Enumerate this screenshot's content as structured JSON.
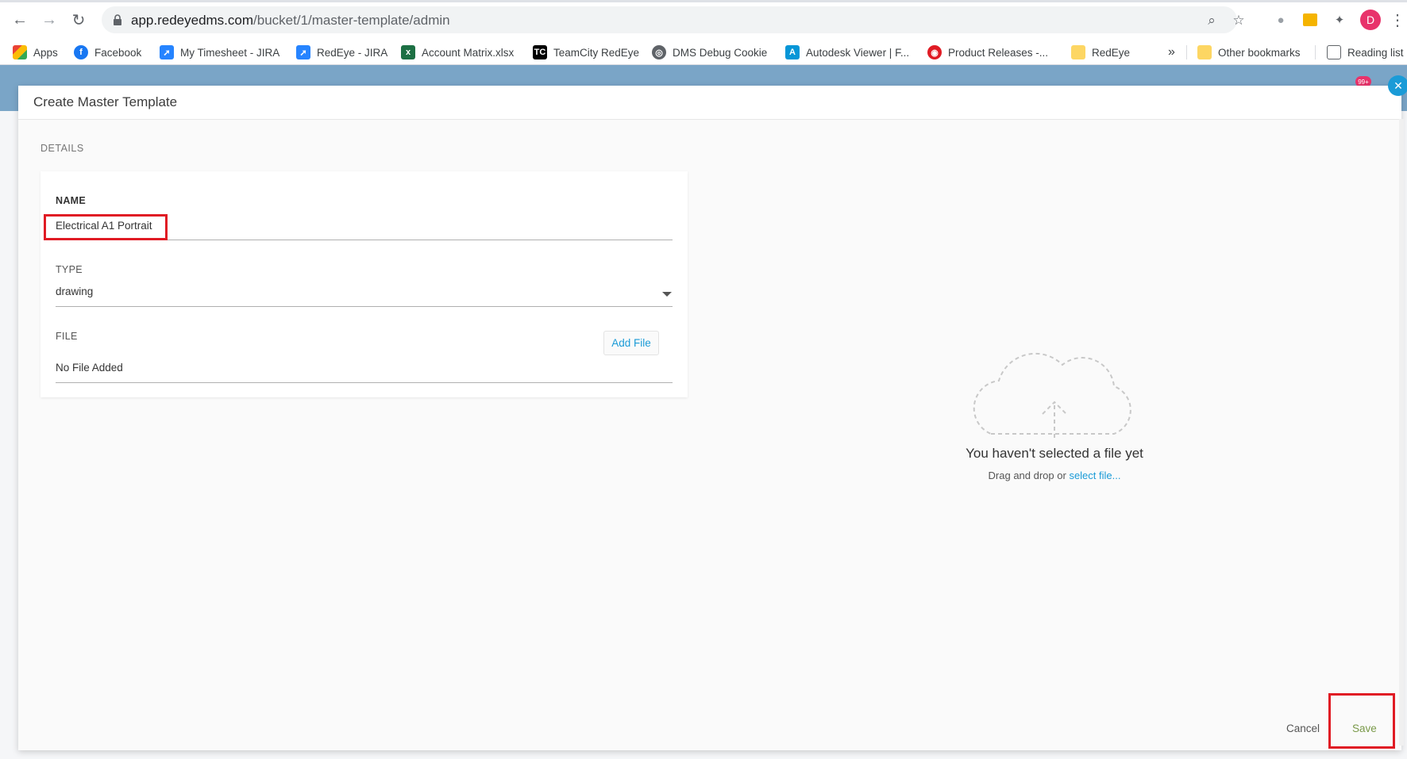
{
  "browser": {
    "url_host": "app.redeyedms.com",
    "url_path": "/bucket/1/master-template/admin",
    "profile_initial": "D",
    "bookmarks": [
      {
        "label": "Apps",
        "icon": "apps-grid-icon"
      },
      {
        "label": "Facebook",
        "icon": "facebook-icon"
      },
      {
        "label": "My Timesheet - JIRA",
        "icon": "jira-icon"
      },
      {
        "label": "RedEye - JIRA",
        "icon": "jira-icon"
      },
      {
        "label": "Account Matrix.xlsx",
        "icon": "excel-icon"
      },
      {
        "label": "TeamCity RedEye",
        "icon": "teamcity-icon"
      },
      {
        "label": "DMS Debug Cookie",
        "icon": "globe-icon"
      },
      {
        "label": "Autodesk Viewer | F...",
        "icon": "autodesk-icon"
      },
      {
        "label": "Product Releases -...",
        "icon": "redeye-icon"
      },
      {
        "label": "RedEye",
        "icon": "folder-icon"
      }
    ],
    "bookmarks_overflow": "»",
    "other_bookmarks": "Other bookmarks",
    "reading_list": "Reading list",
    "notification_count": "99+"
  },
  "dialog": {
    "title": "Create Master Template",
    "details_heading": "DETAILS",
    "name_label": "NAME",
    "name_value": "Electrical A1 Portrait",
    "type_label": "TYPE",
    "type_value": "drawing",
    "file_label": "FILE",
    "file_value": "No File Added",
    "add_file_label": "Add File",
    "upload_title": "You haven't selected a file yet",
    "upload_hint_prefix": "Drag and drop or ",
    "upload_hint_link": "select file...",
    "cancel_label": "Cancel",
    "save_label": "Save"
  },
  "colors": {
    "accent": "#1a9bd7",
    "highlight": "#e01b24",
    "app_header": "#7aa5c7"
  }
}
